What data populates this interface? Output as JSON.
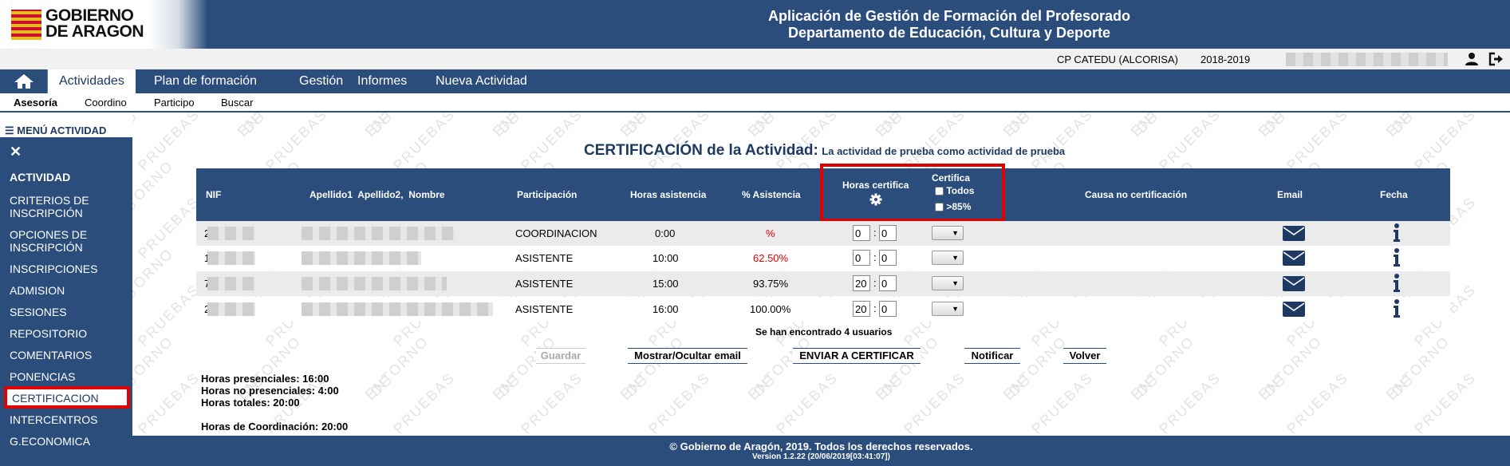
{
  "header": {
    "logo_line1": "GOBIERNO",
    "logo_line2": "DE ARAGON",
    "title_line1": "Aplicación de Gestión de Formación del Profesorado",
    "title_line2": "Departamento de Educación, Cultura y Deporte"
  },
  "infobar": {
    "school": "CP CATEDU (ALCORISA)",
    "year": "2018-2019"
  },
  "nav": {
    "items": [
      "Actividades",
      "Plan de formación",
      "Gestión",
      "Informes",
      "Nueva Actividad"
    ],
    "sub": [
      "Asesoría",
      "Coordino",
      "Participo",
      "Buscar"
    ]
  },
  "watermark": {
    "text": "ENTORNO DE PRUEBAS"
  },
  "sidebar": {
    "menu_title": "☰ MENÚ ACTIVIDAD",
    "close": "✕",
    "heading": "ACTIVIDAD",
    "items": [
      "CRITERIOS DE INSCRIPCIÓN",
      "OPCIONES DE INSCRIPCIÓN",
      "INSCRIPCIONES",
      "ADMISION",
      "SESIONES",
      "REPOSITORIO",
      "COMENTARIOS",
      "PONENCIAS",
      "CERTIFICACION",
      "INTERCENTROS",
      "G.ECONOMICA"
    ]
  },
  "main": {
    "title": "CERTIFICACIÓN de la Actividad:",
    "subtitle": "La actividad de prueba como actividad de prueba",
    "columns": {
      "nif": "NIF",
      "name": "Apellido1  Apellido2,  Nombre",
      "participacion": "Participación",
      "horas_asistencia": "Horas asistencia",
      "pct_asistencia": "% Asistencia",
      "horas_certifica": "Horas certifica",
      "certifica": "Certifica",
      "todos": "Todos",
      "gt85": ">85%",
      "causa": "Causa no certificación",
      "email": "Email",
      "fecha": "Fecha"
    },
    "rows": [
      {
        "nif_prefix": "2",
        "participacion": "COORDINACION",
        "horas": "0:00",
        "pct": "%",
        "h": "0",
        "m": "0"
      },
      {
        "nif_prefix": "1",
        "participacion": "ASISTENTE",
        "horas": "10:00",
        "pct": "62.50%",
        "h": "0",
        "m": "0"
      },
      {
        "nif_prefix": "7",
        "participacion": "ASISTENTE",
        "horas": "15:00",
        "pct": "93.75%",
        "h": "20",
        "m": "0"
      },
      {
        "nif_prefix": "2",
        "participacion": "ASISTENTE",
        "horas": "16:00",
        "pct": "100.00%",
        "h": "20",
        "m": "0"
      }
    ],
    "found": "Se han encontrado 4 usuarios",
    "buttons": {
      "guardar": "Guardar",
      "mostrar": "Mostrar/Ocultar email",
      "enviar": "ENVIAR A CERTIFICAR",
      "notificar": "Notificar",
      "volver": "Volver"
    },
    "totals": {
      "presenciales": "Horas presenciales: 16:00",
      "no_presenciales": "Horas no presenciales: 4:00",
      "totales": "Horas totales: 20:00",
      "coordinacion": "Horas de Coordinación: 20:00"
    }
  },
  "footer": {
    "copyright": "© Gobierno de Aragón, 2019. Todos los derechos reservados.",
    "version": "Version 1.2.22 (20/06/2019[03:41:07])"
  },
  "colors": {
    "brand": "#2b4d7c",
    "highlight": "#e00000",
    "warning_text": "#e00000"
  }
}
